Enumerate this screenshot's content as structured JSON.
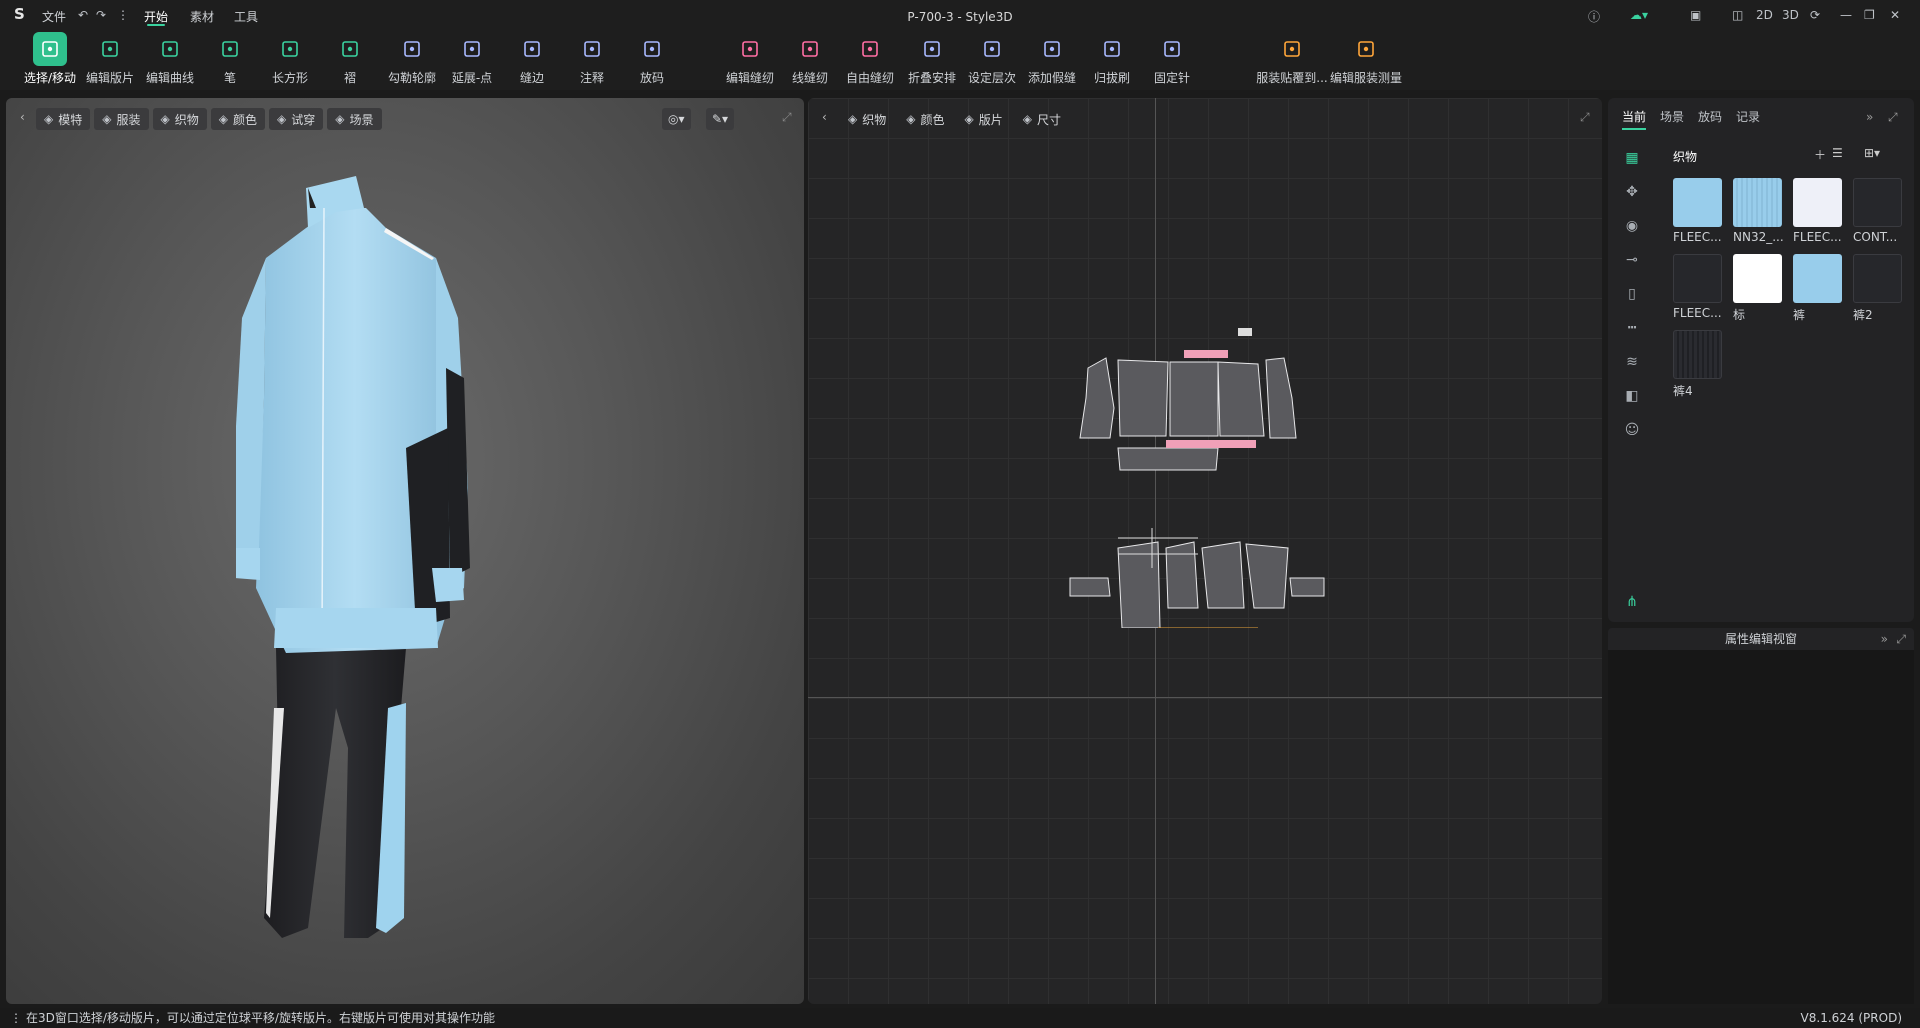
{
  "app": {
    "title": "P-700-3 - Style3D",
    "menus": [
      "文件",
      "开始",
      "素材",
      "工具"
    ],
    "active_menu": "开始",
    "right_controls": [
      "2D",
      "3D"
    ]
  },
  "toolbar": {
    "tools": [
      {
        "label": "选择/移动",
        "icon": "select-move-icon",
        "active": true
      },
      {
        "label": "编辑版片",
        "icon": "edit-pattern-icon"
      },
      {
        "label": "编辑曲线",
        "icon": "edit-curve-icon"
      },
      {
        "label": "笔",
        "icon": "pen-icon"
      },
      {
        "label": "长方形",
        "icon": "rectangle-icon"
      },
      {
        "label": "褶",
        "icon": "pleat-icon"
      },
      {
        "label": "勾勒轮廓",
        "icon": "trace-outline-icon"
      },
      {
        "label": "延展-点",
        "icon": "extend-point-icon"
      },
      {
        "label": "缝边",
        "icon": "seam-allowance-icon"
      },
      {
        "label": "注释",
        "icon": "annotation-icon"
      },
      {
        "label": "放码",
        "icon": "grading-icon"
      },
      {
        "label": "编辑缝纫",
        "icon": "edit-sewing-icon"
      },
      {
        "label": "线缝纫",
        "icon": "line-sewing-icon"
      },
      {
        "label": "自由缝纫",
        "icon": "free-sewing-icon"
      },
      {
        "label": "折叠安排",
        "icon": "fold-arrange-icon"
      },
      {
        "label": "设定层次",
        "icon": "set-layer-icon"
      },
      {
        "label": "添加假缝",
        "icon": "add-tack-icon"
      },
      {
        "label": "归拔刷",
        "icon": "shrink-brush-icon"
      },
      {
        "label": "固定针",
        "icon": "pin-icon"
      },
      {
        "label": "服装贴覆到...",
        "icon": "garment-fit-icon"
      },
      {
        "label": "编辑服装测量",
        "icon": "garment-measure-icon"
      }
    ]
  },
  "viewport3d": {
    "buttons": [
      "模特",
      "服装",
      "织物",
      "颜色",
      "试穿",
      "场景"
    ]
  },
  "viewport2d": {
    "buttons": [
      "织物",
      "颜色",
      "版片",
      "尺寸"
    ]
  },
  "right_panel": {
    "tabs": [
      "当前",
      "场景",
      "放码",
      "记录"
    ],
    "active_tab": "当前",
    "section_title": "织物",
    "fabrics": [
      {
        "label": "FLEEC...",
        "color": "#98cdeb",
        "pattern": "solid"
      },
      {
        "label": "NN32_...",
        "color": "#98cdeb",
        "pattern": "ribbed"
      },
      {
        "label": "FLEEC...",
        "color": "#eef0f8",
        "pattern": "solid"
      },
      {
        "label": "CONT...",
        "color": "#26272b",
        "pattern": "solid"
      },
      {
        "label": "FLEEC...",
        "color": "#26272b",
        "pattern": "solid"
      },
      {
        "label": "标",
        "color": "#ffffff",
        "pattern": "solid"
      },
      {
        "label": "裤",
        "color": "#98cdeb",
        "pattern": "solid"
      },
      {
        "label": "裤2",
        "color": "#26272b",
        "pattern": "solid"
      },
      {
        "label": "裤4",
        "color": "#2a2b30",
        "pattern": "ribbed-dark"
      }
    ]
  },
  "properties": {
    "title": "属性编辑视窗"
  },
  "status": {
    "message": "在3D窗口选择/移动版片，可以通过定位球平移/旋转版片。右键版片可使用对其操作功能",
    "version": "V8.1.624 (PROD)"
  }
}
